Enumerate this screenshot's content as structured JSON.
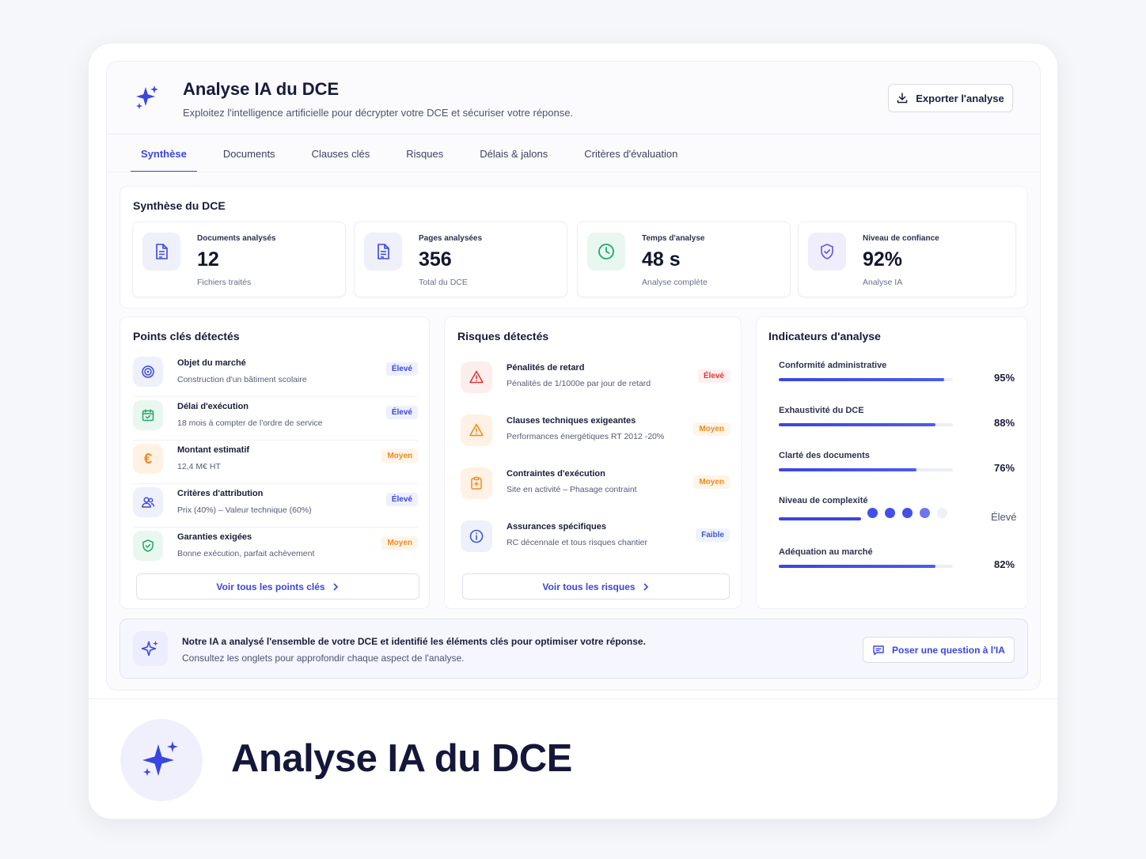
{
  "header": {
    "title": "Analyse IA du DCE",
    "subtitle": "Exploitez l'intelligence artificielle pour décrypter votre DCE et sécuriser votre réponse.",
    "export_label": "Exporter l'analyse"
  },
  "tabs": [
    {
      "label": "Synthèse",
      "active": true
    },
    {
      "label": "Documents"
    },
    {
      "label": "Clauses clés"
    },
    {
      "label": "Risques"
    },
    {
      "label": "Délais & jalons"
    },
    {
      "label": "Critères d'évaluation"
    }
  ],
  "synthese": {
    "title": "Synthèse du DCE",
    "stats": [
      {
        "label": "Documents analysés",
        "value": "12",
        "sub": "Fichiers traités",
        "icon": "document-icon"
      },
      {
        "label": "Pages analysées",
        "value": "356",
        "sub": "Total du DCE",
        "icon": "pages-icon"
      },
      {
        "label": "Temps d'analyse",
        "value": "48 s",
        "sub": "Analyse complète",
        "icon": "clock-icon"
      },
      {
        "label": "Niveau de confiance",
        "value": "92%",
        "sub": "Analyse IA",
        "icon": "shield-check-icon"
      }
    ]
  },
  "key_points": {
    "title": "Points clés détectés",
    "items": [
      {
        "title": "Objet du marché",
        "desc": "Construction d'un bâtiment scolaire",
        "badge": "Élevé",
        "level": "high",
        "icon": "target-icon"
      },
      {
        "title": "Délai d'exécution",
        "desc": "18 mois à compter de l'ordre de service",
        "badge": "Élevé",
        "level": "high",
        "icon": "calendar-icon"
      },
      {
        "title": "Montant estimatif",
        "desc": "12,4 M€ HT",
        "badge": "Moyen",
        "level": "mid",
        "icon": "euro-icon"
      },
      {
        "title": "Critères d'attribution",
        "desc": "Prix (40%) – Valeur technique (60%)",
        "badge": "Élevé",
        "level": "high",
        "icon": "users-icon"
      },
      {
        "title": "Garanties exigées",
        "desc": "Bonne exécution, parfait achèvement",
        "badge": "Moyen",
        "level": "mid",
        "icon": "shield-icon"
      }
    ],
    "link_label": "Voir tous les points clés"
  },
  "risks": {
    "title": "Risques détectés",
    "items": [
      {
        "title": "Pénalités de retard",
        "desc": "Pénalités de 1/1000e par jour de retard",
        "badge": "Élevé",
        "level": "high-red",
        "icon": "alert-triangle-icon"
      },
      {
        "title": "Clauses techniques exigeantes",
        "desc": "Performances énergétiques RT 2012 -20%",
        "badge": "Moyen",
        "level": "mid",
        "icon": "warning-icon"
      },
      {
        "title": "Contraintes d'exécution",
        "desc": "Site en activité – Phasage contraint",
        "badge": "Moyen",
        "level": "mid",
        "icon": "clipboard-icon"
      },
      {
        "title": "Assurances spécifiques",
        "desc": "RC décennale et tous risques chantier",
        "badge": "Faible",
        "level": "low",
        "icon": "info-icon"
      }
    ],
    "link_label": "Voir tous les risques"
  },
  "indicators": {
    "title": "Indicateurs d'analyse",
    "items": [
      {
        "label": "Conformité administrative",
        "value": "95%",
        "fraction": 0.95
      },
      {
        "label": "Exhaustivité du DCE",
        "value": "88%",
        "fraction": 0.9
      },
      {
        "label": "Clarté des documents",
        "value": "76%",
        "fraction": 0.79
      },
      {
        "label": "Niveau de complexité",
        "value": "Élevé",
        "dots_on": 4,
        "dots_total": 5
      },
      {
        "label": "Adéquation au marché",
        "value": "82%",
        "fraction": 0.9
      }
    ]
  },
  "ia_banner": {
    "line1": "Notre IA a analysé l'ensemble de votre DCE et identifié les éléments clés pour optimiser votre réponse.",
    "line2": "Consultez les onglets pour approfondir chaque aspect de l'analyse.",
    "button_label": "Poser une question à l'IA"
  },
  "footer": {
    "title": "Analyse IA du DCE"
  },
  "colors": {
    "accent": "#3b45e0",
    "high": "#3b45e0",
    "high_red": "#e03838",
    "mid": "#f08a1c",
    "green": "#1fa86a",
    "purple": "#6b5ad6"
  }
}
